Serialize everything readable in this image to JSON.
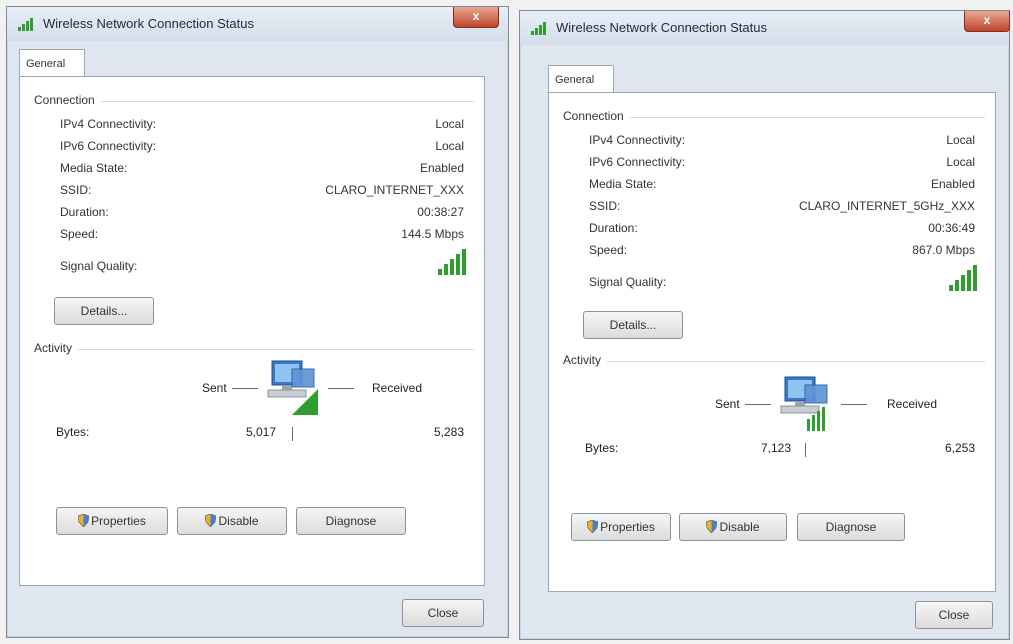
{
  "left": {
    "title": "Wireless Network Connection Status",
    "close_symbol": "x",
    "tab": "General",
    "connection_label": "Connection",
    "rows": [
      {
        "label": "IPv4 Connectivity:",
        "value": "Local"
      },
      {
        "label": "IPv6 Connectivity:",
        "value": "Local"
      },
      {
        "label": "Media State:",
        "value": "Enabled"
      },
      {
        "label": "SSID:",
        "value": "CLARO_INTERNET_XXX"
      },
      {
        "label": "Duration:",
        "value": "00:38:27"
      },
      {
        "label": "Speed:",
        "value": "144.5 Mbps"
      }
    ],
    "signal_label": "Signal Quality:",
    "details_button": "Details...",
    "activity_label": "Activity",
    "sent_label": "Sent",
    "received_label": "Received",
    "bytes_label": "Bytes:",
    "bytes_sent": "5,017",
    "bytes_received": "5,283",
    "properties_button": "Properties",
    "disable_button": "Disable",
    "diagnose_button": "Diagnose",
    "close_button": "Close"
  },
  "right": {
    "title": "Wireless Network Connection Status",
    "close_symbol": "x",
    "tab": "General",
    "connection_label": "Connection",
    "rows": [
      {
        "label": "IPv4 Connectivity:",
        "value": "Local"
      },
      {
        "label": "IPv6 Connectivity:",
        "value": "Local"
      },
      {
        "label": "Media State:",
        "value": "Enabled"
      },
      {
        "label": "SSID:",
        "value": "CLARO_INTERNET_5GHz_XXX"
      },
      {
        "label": "Duration:",
        "value": "00:36:49"
      },
      {
        "label": "Speed:",
        "value": "867.0 Mbps"
      }
    ],
    "signal_label": "Signal Quality:",
    "details_button": "Details...",
    "activity_label": "Activity",
    "sent_label": "Sent",
    "received_label": "Received",
    "bytes_label": "Bytes:",
    "bytes_sent": "7,123",
    "bytes_received": "6,253",
    "properties_button": "Properties",
    "disable_button": "Disable",
    "diagnose_button": "Diagnose",
    "close_button": "Close"
  },
  "colors": {
    "signal_green": "#2f9e2f",
    "title_bar": "#dfe6ef",
    "close_red": "#c0452d"
  },
  "icons": {
    "title": "wireless-signal-icon",
    "signal": "signal-bars-icon",
    "activity": "network-computer-icon",
    "button": "uac-shield-icon"
  }
}
